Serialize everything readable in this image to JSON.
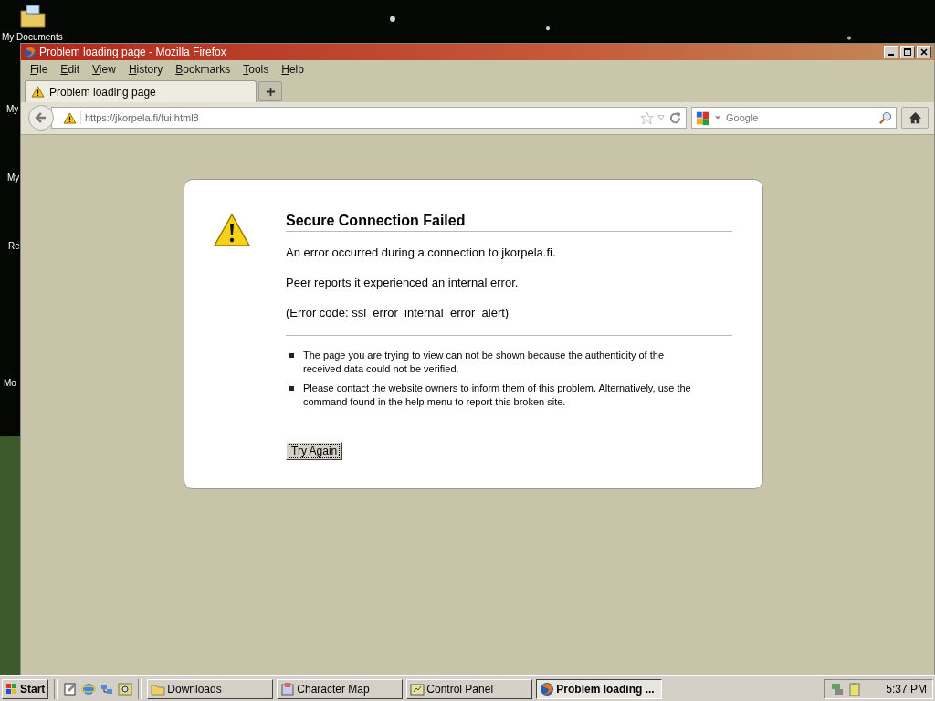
{
  "desktop": {
    "icons": [
      {
        "label": "My Documents"
      },
      {
        "label": "My"
      },
      {
        "label": "My"
      },
      {
        "label": "Re"
      },
      {
        "label": "Mo"
      }
    ]
  },
  "window": {
    "title": "Problem loading page - Mozilla Firefox"
  },
  "menu": [
    "File",
    "Edit",
    "View",
    "History",
    "Bookmarks",
    "Tools",
    "Help"
  ],
  "tabs": [
    {
      "label": "Problem loading page",
      "selected": true
    }
  ],
  "address": {
    "value": "https://jkorpela.fi/fui.html8"
  },
  "search": {
    "placeholder": "Google"
  },
  "error": {
    "title": "Secure Connection Failed",
    "lines": [
      "An error occurred during a connection to jkorpela.fi.",
      "Peer reports it experienced an internal error.",
      "(Error code: ssl_error_internal_error_alert)"
    ],
    "bullets": [
      "The page you are trying to view can not be shown because the authenticity of the received data could not be verified.",
      "Please contact the website owners to inform them of this problem. Alternatively, use the command found in the help menu to report this broken site."
    ],
    "button": "Try Again"
  },
  "taskbar": {
    "start": "Start",
    "tasks": [
      {
        "label": "Downloads",
        "kind": "folder",
        "selected": false
      },
      {
        "label": "Character Map",
        "kind": "charmap",
        "selected": false
      },
      {
        "label": "Control Panel",
        "kind": "panel",
        "selected": false
      },
      {
        "label": "Problem loading ...",
        "kind": "browser",
        "selected": true
      }
    ],
    "clock": "5:37 PM"
  }
}
